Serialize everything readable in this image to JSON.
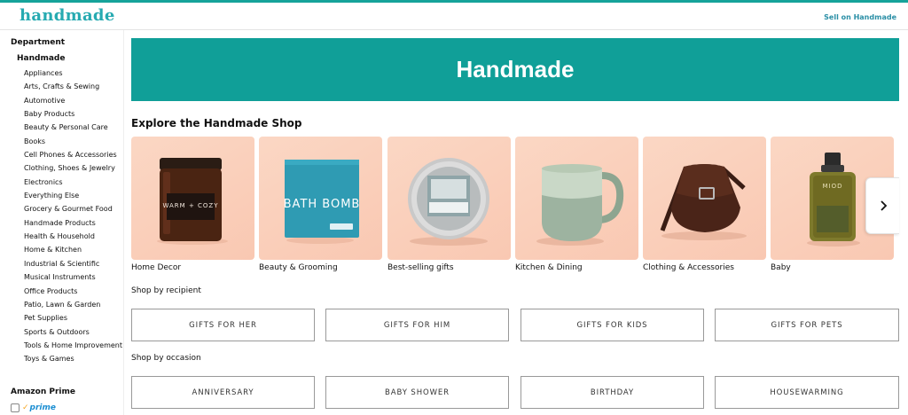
{
  "header": {
    "logo": "handmade",
    "sell_link": "Sell on Handmade",
    "accent_color": "#16a39a"
  },
  "sidebar": {
    "heading": "Department",
    "current": "Handmade",
    "items": [
      "Appliances",
      "Arts, Crafts & Sewing",
      "Automotive",
      "Baby Products",
      "Beauty & Personal Care",
      "Books",
      "Cell Phones & Accessories",
      "Clothing, Shoes & Jewelry",
      "Electronics",
      "Everything Else",
      "Grocery & Gourmet Food",
      "Handmade Products",
      "Health & Household",
      "Home & Kitchen",
      "Industrial & Scientific",
      "Musical Instruments",
      "Office Products",
      "Patio, Lawn & Garden",
      "Pet Supplies",
      "Sports & Outdoors",
      "Tools & Home Improvement",
      "Toys & Games"
    ],
    "prime_heading": "Amazon Prime",
    "prime_logo": "prime"
  },
  "hero": {
    "title": "Handmade",
    "color": "#109f98"
  },
  "explore": {
    "title": "Explore the Handmade Shop",
    "cards": [
      {
        "label": "Home Decor",
        "icon": "candle-jar",
        "product_text": "WARM + COZY"
      },
      {
        "label": "Beauty & Grooming",
        "icon": "bath-bomb-box",
        "product_text": "BATH BOMB"
      },
      {
        "label": "Best-selling gifts",
        "icon": "soap-tin"
      },
      {
        "label": "Kitchen & Dining",
        "icon": "ceramic-mug"
      },
      {
        "label": "Clothing & Accessories",
        "icon": "leather-bag"
      },
      {
        "label": "Baby",
        "icon": "oil-bottle",
        "product_text": "MIOD"
      }
    ]
  },
  "recipients": {
    "heading": "Shop by recipient",
    "items": [
      "GIFTS FOR HER",
      "GIFTS FOR HIM",
      "GIFTS FOR KIDS",
      "GIFTS FOR PETS"
    ]
  },
  "occasions": {
    "heading": "Shop by occasion",
    "items": [
      "ANNIVERSARY",
      "BABY SHOWER",
      "BIRTHDAY",
      "HOUSEWARMING"
    ]
  }
}
